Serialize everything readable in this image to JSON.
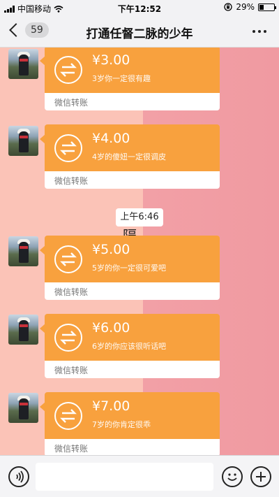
{
  "status_bar": {
    "carrier": "中国移动",
    "time": "下午12:52",
    "battery_percent": "29%",
    "battery_level": 0.29,
    "icons": [
      "signal-icon",
      "wifi-icon",
      "orientation-lock-icon",
      "battery-icon"
    ]
  },
  "nav": {
    "back_icon": "chevron-left-icon",
    "unread_count": "59",
    "title": "打通任督二脉的少年",
    "more_icon": "ellipsis-icon"
  },
  "chat": {
    "messages": [
      {
        "amount": "¥3.00",
        "memo": "3岁你一定很有趣",
        "label": "微信转账"
      },
      {
        "amount": "¥4.00",
        "memo": "4岁的傻妞一定很调皮",
        "label": "微信转账"
      },
      {
        "amount": "¥5.00",
        "memo": "5岁的你一定很可爱吧",
        "label": "微信转账"
      },
      {
        "amount": "¥6.00",
        "memo": "6岁的你应该很听话吧",
        "label": "微信转账"
      },
      {
        "amount": "¥7.00",
        "memo": "7岁的你肯定很乖",
        "label": "微信转账"
      }
    ],
    "timestamp": "上午6:46",
    "background_glyph": "隔"
  },
  "input_bar": {
    "value": "",
    "icons": [
      "voice-icon",
      "emoji-icon",
      "plus-icon"
    ]
  },
  "colors": {
    "transfer_orange": "#f8a13e",
    "bg_left": "#fbc3b7",
    "bg_right": "#f2a0a6"
  }
}
